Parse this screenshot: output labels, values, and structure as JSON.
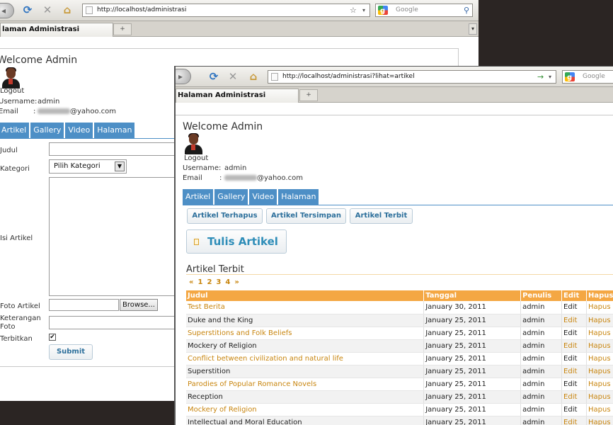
{
  "back_window": {
    "url": "http://localhost/administrasi",
    "search_placeholder": "Google",
    "tab_title": "laman Administrasi",
    "new_tab": "+",
    "welcome": "Welcome Admin",
    "logout": "Logout",
    "username_label": "Username:",
    "username_value": "admin",
    "email_label": "Email",
    "email_sep": ":",
    "email_domain": "@yahoo.com",
    "tabs": [
      "Artikel",
      "Gallery",
      "Video",
      "Halaman"
    ],
    "form": {
      "judul_label": "Judul",
      "kategori_label": "Kategori",
      "kategori_value": "Pilih Kategori",
      "isi_label": "Isi Artikel",
      "foto_label": "Foto Artikel",
      "browse_label": "Browse...",
      "keterangan_label": "Keterangan Foto",
      "terbitkan_label": "Terbitkan",
      "terbitkan_checked": "✔",
      "submit_label": "Submit"
    }
  },
  "front_window": {
    "url": "http://localhost/administrasi?lihat=artikel",
    "search_placeholder": "Google",
    "tab_title": "Halaman Administrasi",
    "new_tab": "+",
    "welcome": "Welcome Admin",
    "logout": "Logout",
    "username_label": "Username:",
    "username_value": "admin",
    "email_label": "Email",
    "email_sep": ":",
    "email_domain": "@yahoo.com",
    "tabs": [
      "Artikel",
      "Gallery",
      "Video",
      "Halaman"
    ],
    "sub_buttons": [
      "Artikel Terhapus",
      "Artikel Tersimpan",
      "Artikel Terbit"
    ],
    "write_button": "Tulis Artikel",
    "section_title": "Artikel Terbit",
    "pager": [
      "«",
      "1",
      "2",
      "3",
      "4",
      "»"
    ],
    "table": {
      "headers": [
        "Judul",
        "Tanggal",
        "Penulis",
        "Edit",
        "Hapus"
      ],
      "rows": [
        [
          "Test Berita",
          "January 30, 2011",
          "admin",
          "Edit",
          "Hapus"
        ],
        [
          "Duke and the King",
          "January 25, 2011",
          "admin",
          "Edit",
          "Hapus"
        ],
        [
          "Superstitions and Folk Beliefs",
          "January 25, 2011",
          "admin",
          "Edit",
          "Hapus"
        ],
        [
          "Mockery of Religion",
          "January 25, 2011",
          "admin",
          "Edit",
          "Hapus"
        ],
        [
          "Conflict between civilization and natural life",
          "January 25, 2011",
          "admin",
          "Edit",
          "Hapus"
        ],
        [
          "Superstition",
          "January 25, 2011",
          "admin",
          "Edit",
          "Hapus"
        ],
        [
          "Parodies of Popular Romance Novels",
          "January 25, 2011",
          "admin",
          "Edit",
          "Hapus"
        ],
        [
          "Reception",
          "January 25, 2011",
          "admin",
          "Edit",
          "Hapus"
        ],
        [
          "Mockery of Religion",
          "January 25, 2011",
          "admin",
          "Edit",
          "Hapus"
        ],
        [
          "Intellectual and Moral Education",
          "January 25, 2011",
          "admin",
          "Edit",
          "Hapus"
        ]
      ]
    }
  },
  "colors": {
    "tab_blue": "#4d8fc6",
    "link_orange": "#c8850e",
    "table_header": "#f4a743",
    "button_text": "#2c6f9b",
    "desktop": "#2b2523"
  }
}
